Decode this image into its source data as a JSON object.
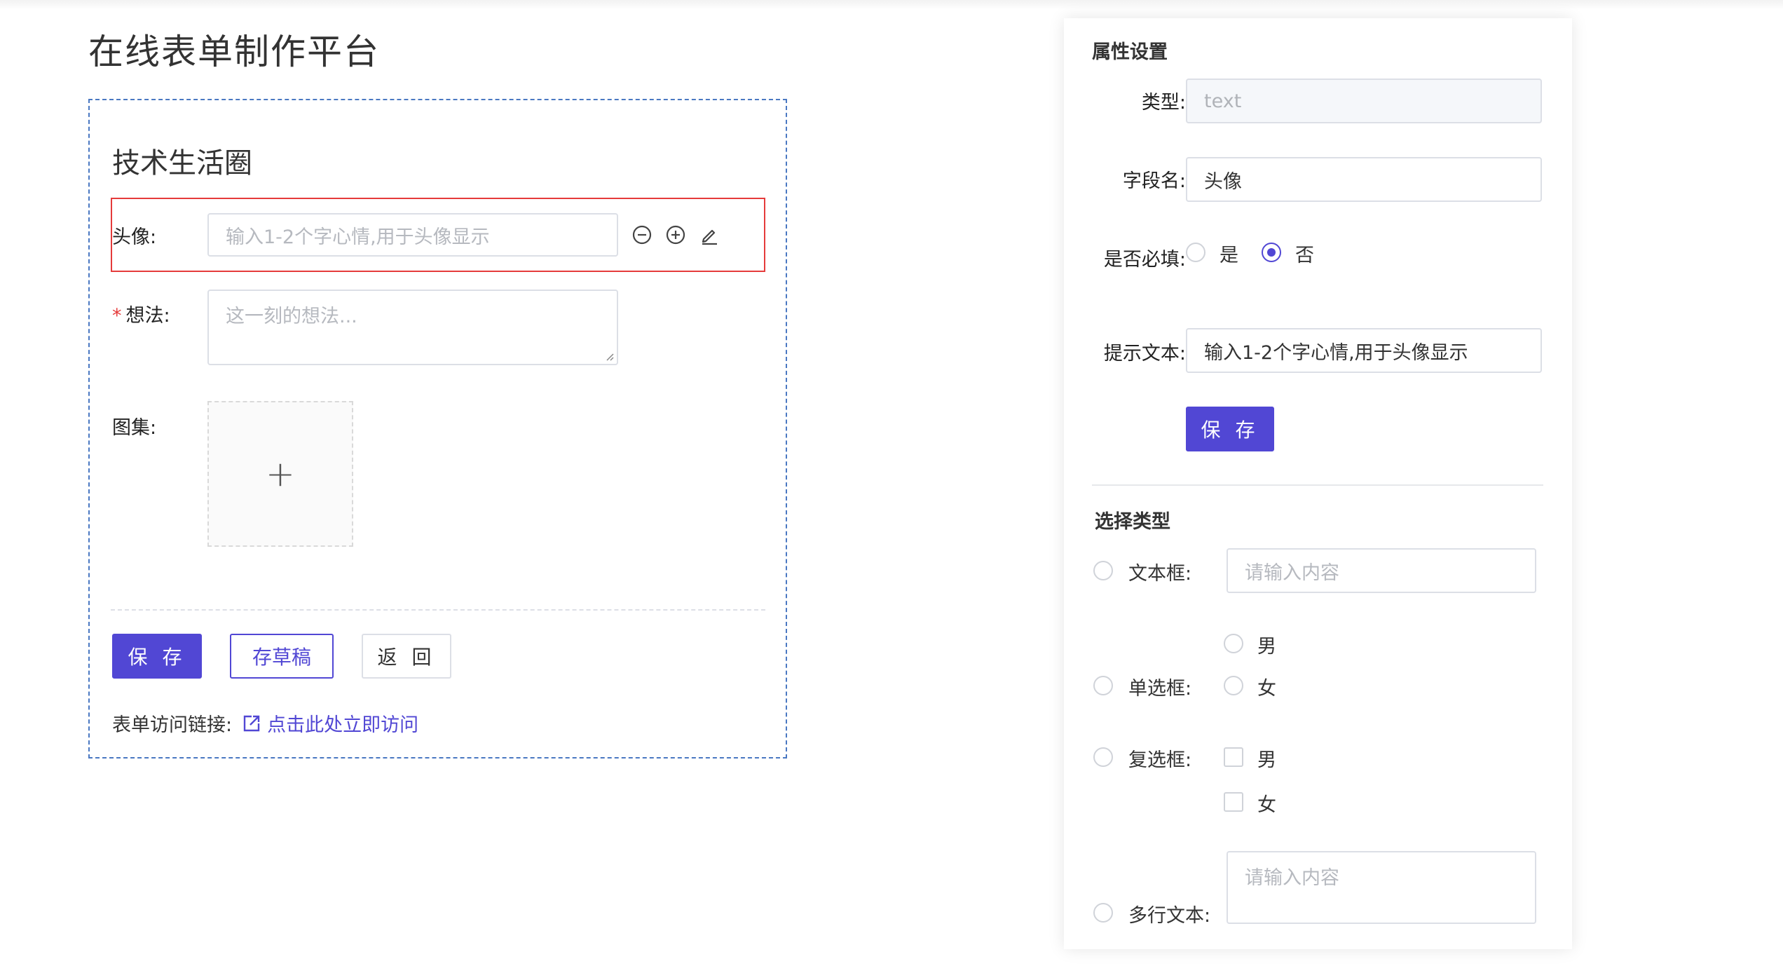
{
  "page": {
    "title": "在线表单制作平台"
  },
  "form": {
    "title": "技术生活圈",
    "fields": {
      "avatar": {
        "label": "头像:",
        "placeholder": "输入1-2个字心情,用于头像显示"
      },
      "thought": {
        "required_mark": "*",
        "label": "想法:",
        "placeholder": "这一刻的想法..."
      },
      "gallery": {
        "label": "图集:",
        "upload_symbol": "+"
      }
    },
    "buttons": {
      "save": "保 存",
      "draft": "存草稿",
      "back": "返 回"
    },
    "link": {
      "label": "表单访问链接:",
      "text": "点击此处立即访问"
    }
  },
  "panel": {
    "attr_title": "属性设置",
    "type": {
      "label": "类型:",
      "value": "text"
    },
    "field_name": {
      "label": "字段名:",
      "value": "头像"
    },
    "required": {
      "label": "是否必填:",
      "yes": "是",
      "no": "否",
      "selected": "否"
    },
    "hint": {
      "label": "提示文本:",
      "value": "输入1-2个字心情,用于头像显示"
    },
    "save_label": "保 存",
    "choose_title": "选择类型",
    "types": {
      "text": {
        "label": "文本框:",
        "placeholder": "请输入内容"
      },
      "radio": {
        "label": "单选框:",
        "options": [
          "男",
          "女"
        ]
      },
      "checkbox": {
        "label": "复选框:",
        "options": [
          "男",
          "女"
        ]
      },
      "textarea": {
        "label": "多行文本:",
        "placeholder": "请输入内容"
      }
    }
  },
  "colors": {
    "primary": "#5147d4",
    "error": "#e53b3b",
    "border": "#dcdfe6",
    "dashed_frame": "#4a78c2"
  }
}
